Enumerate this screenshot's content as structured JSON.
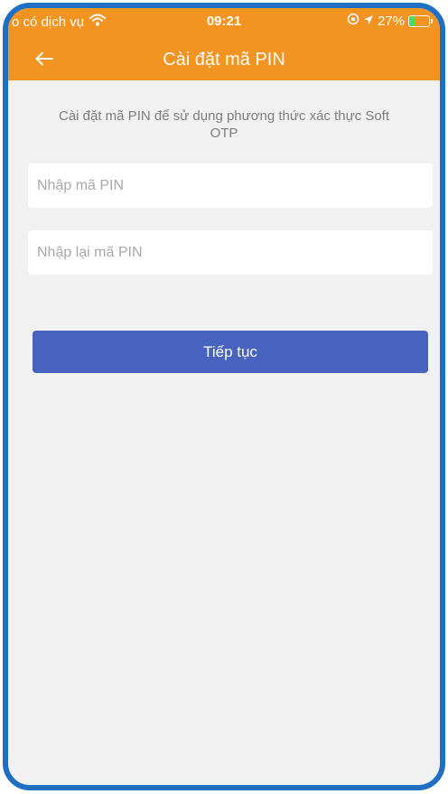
{
  "status_bar": {
    "carrier": "o có dịch vụ",
    "time": "09:21",
    "battery_percent": "27%",
    "battery_level": 0.27,
    "icons": [
      "wifi-icon",
      "orientation-lock-icon",
      "location-icon",
      "battery-icon"
    ]
  },
  "header": {
    "title": "Cài đặt mã PIN",
    "back_icon": "arrow-left-icon"
  },
  "main": {
    "description": "Cài đặt mã PIN để sử dụng phương thức xác thực Soft OTP",
    "pin_placeholder": "Nhập mã PIN",
    "pin_value": "",
    "pin_confirm_placeholder": "Nhập lại mã PIN",
    "pin_confirm_value": "",
    "continue_label": "Tiếp tục"
  },
  "colors": {
    "header_background": "#f39320",
    "button_background": "#4863bd",
    "page_background": "#f1f1f1",
    "frame_border": "#1f6fc2"
  }
}
